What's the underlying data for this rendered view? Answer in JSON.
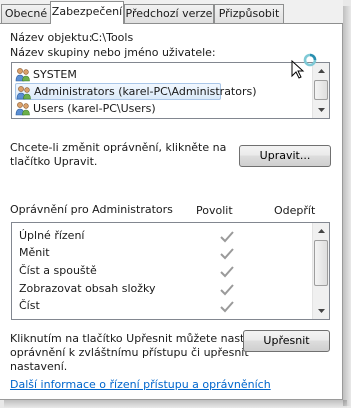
{
  "tabs": [
    {
      "label": "Obecné",
      "active": false
    },
    {
      "label": "Zabezpečení",
      "active": true
    },
    {
      "label": "Předchozí verze",
      "active": false
    },
    {
      "label": "Přizpůsobit",
      "active": false
    }
  ],
  "object": {
    "label": "Název objektu:",
    "value": "C:\\Tools"
  },
  "groups": {
    "label": "Název skupiny nebo jméno uživatele:",
    "items": [
      {
        "name": "SYSTEM",
        "icon": "users-group-icon",
        "selected": false
      },
      {
        "name": "Administrators (karel-PC\\Administrators)",
        "icon": "users-group-icon",
        "selected": true
      },
      {
        "name": "Users (karel-PC\\Users)",
        "icon": "users-group-icon",
        "selected": false
      }
    ]
  },
  "edit": {
    "text_line1": "Chcete-li změnit oprávnění, klikněte na",
    "text_line2": "tlačítko Upravit.",
    "button": "Upravit..."
  },
  "permissions": {
    "title": "Oprávnění pro Administrators",
    "allow_header": "Povolit",
    "deny_header": "Odepřít",
    "rows": [
      {
        "name": "Úplné řízení",
        "allow": true,
        "deny": false
      },
      {
        "name": "Měnit",
        "allow": true,
        "deny": false
      },
      {
        "name": "Číst a spouště",
        "allow": true,
        "deny": false
      },
      {
        "name": "Zobrazovat obsah složky",
        "allow": true,
        "deny": false
      },
      {
        "name": "Číst",
        "allow": true,
        "deny": false
      }
    ]
  },
  "advanced": {
    "text_line1": "Kliknutím na tlačítko Upřesnit můžete nastavit",
    "text_line2": "oprávnění k zvláštnímu přístupu či upřesnit",
    "text_line3": "nastavení.",
    "button": "Upřesnit"
  },
  "help_link": "Další informace o řízení přístupu a oprávněních",
  "colors": {
    "link": "#0066cc",
    "check": "#9a9a9a",
    "selection": "#dbeaf9"
  }
}
